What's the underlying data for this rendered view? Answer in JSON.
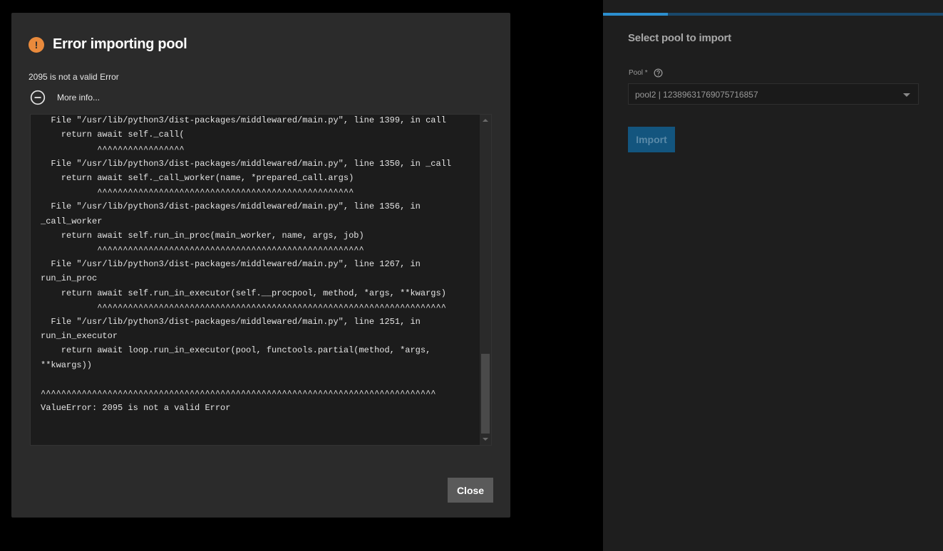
{
  "dialog": {
    "title": "Error importing pool",
    "message": "2095 is not a valid Error",
    "more_info_label": "More info...",
    "close_label": "Close",
    "accent_color": "#e98a3c",
    "icon": "warning-icon",
    "traceback": "  _                _     ,\n  File \"/usr/lib/python3/dist-packages/middlewared/main.py\", line 1399, in call\n    return await self._call(\n           ^^^^^^^^^^^^^^^^^\n  File \"/usr/lib/python3/dist-packages/middlewared/main.py\", line 1350, in _call\n    return await self._call_worker(name, *prepared_call.args)\n           ^^^^^^^^^^^^^^^^^^^^^^^^^^^^^^^^^^^^^^^^^^^^^^^^^^\n  File \"/usr/lib/python3/dist-packages/middlewared/main.py\", line 1356, in\n_call_worker\n    return await self.run_in_proc(main_worker, name, args, job)\n           ^^^^^^^^^^^^^^^^^^^^^^^^^^^^^^^^^^^^^^^^^^^^^^^^^^^^\n  File \"/usr/lib/python3/dist-packages/middlewared/main.py\", line 1267, in\nrun_in_proc\n    return await self.run_in_executor(self.__procpool, method, *args, **kwargs)\n           ^^^^^^^^^^^^^^^^^^^^^^^^^^^^^^^^^^^^^^^^^^^^^^^^^^^^^^^^^^^^^^^^^^^^\n  File \"/usr/lib/python3/dist-packages/middlewared/main.py\", line 1251, in\nrun_in_executor\n    return await loop.run_in_executor(pool, functools.partial(method, *args,\n**kwargs))\n\n^^^^^^^^^^^^^^^^^^^^^^^^^^^^^^^^^^^^^^^^^^^^^^^^^^^^^^^^^^^^^^^^^^^^^^^^^^^^^\nValueError: 2095 is not a valid Error"
  },
  "side_panel": {
    "title": "Select pool to import",
    "pool_label": "Pool *",
    "pool_value": "pool2 | 12389631769075716857",
    "import_label": "Import",
    "progress": 0.19,
    "accent_color": "#2c8fcf"
  }
}
